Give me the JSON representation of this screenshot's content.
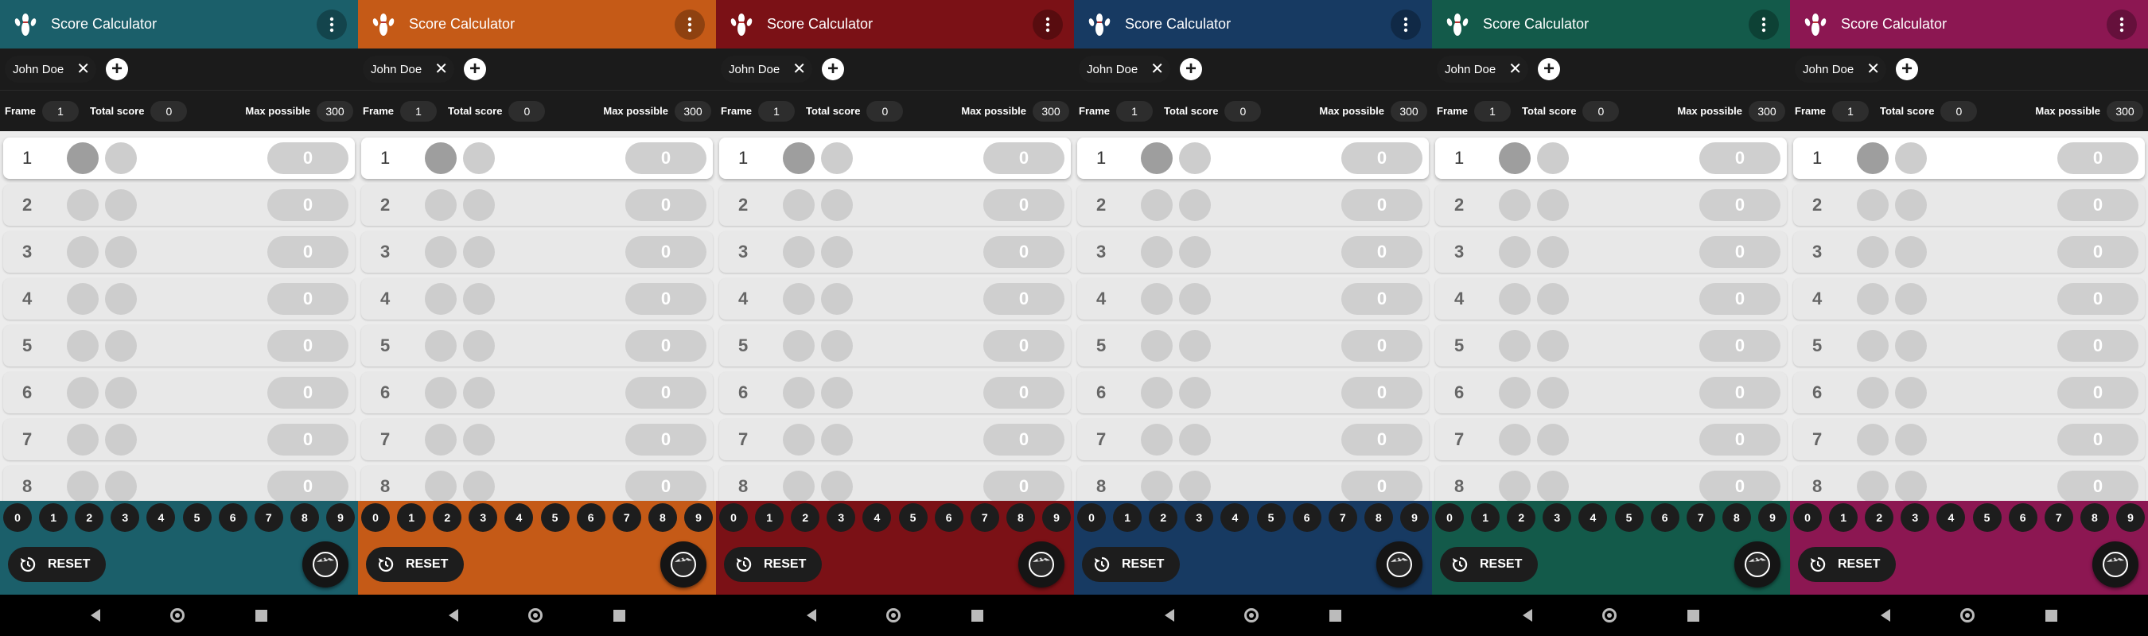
{
  "screens": [
    {
      "theme": {
        "appbar": "#1b5f6a",
        "chip": "#1e1e1e",
        "bottom": "#1b5f6a"
      },
      "app_title": "Score Calculator",
      "player_name": "John Doe",
      "stats": {
        "frame_label": "Frame",
        "frame_value": "1",
        "total_label": "Total score",
        "total_value": "0",
        "max_label": "Max possible",
        "max_value": "300"
      },
      "frames": [
        {
          "num": "1",
          "score": "0",
          "active": true
        },
        {
          "num": "2",
          "score": "0"
        },
        {
          "num": "3",
          "score": "0"
        },
        {
          "num": "4",
          "score": "0"
        },
        {
          "num": "5",
          "score": "0"
        },
        {
          "num": "6",
          "score": "0"
        },
        {
          "num": "7",
          "score": "0"
        },
        {
          "num": "8",
          "score": "0"
        }
      ],
      "pins": [
        "0",
        "1",
        "2",
        "3",
        "4",
        "5",
        "6",
        "7",
        "8",
        "9"
      ],
      "reset_label": "RESET"
    },
    {
      "theme": {
        "appbar": "#c55a17",
        "chip": "#1e1e1e",
        "bottom": "#c55a17"
      },
      "app_title": "Score Calculator",
      "player_name": "John Doe",
      "stats": {
        "frame_label": "Frame",
        "frame_value": "1",
        "total_label": "Total score",
        "total_value": "0",
        "max_label": "Max possible",
        "max_value": "300"
      },
      "frames": [
        {
          "num": "1",
          "score": "0",
          "active": true
        },
        {
          "num": "2",
          "score": "0"
        },
        {
          "num": "3",
          "score": "0"
        },
        {
          "num": "4",
          "score": "0"
        },
        {
          "num": "5",
          "score": "0"
        },
        {
          "num": "6",
          "score": "0"
        },
        {
          "num": "7",
          "score": "0"
        },
        {
          "num": "8",
          "score": "0"
        }
      ],
      "pins": [
        "0",
        "1",
        "2",
        "3",
        "4",
        "5",
        "6",
        "7",
        "8",
        "9"
      ],
      "reset_label": "RESET"
    },
    {
      "theme": {
        "appbar": "#7b1116",
        "chip": "#1e1e1e",
        "bottom": "#7b1116"
      },
      "app_title": "Score Calculator",
      "player_name": "John Doe",
      "stats": {
        "frame_label": "Frame",
        "frame_value": "1",
        "total_label": "Total score",
        "total_value": "0",
        "max_label": "Max possible",
        "max_value": "300"
      },
      "frames": [
        {
          "num": "1",
          "score": "0",
          "active": true
        },
        {
          "num": "2",
          "score": "0"
        },
        {
          "num": "3",
          "score": "0"
        },
        {
          "num": "4",
          "score": "0"
        },
        {
          "num": "5",
          "score": "0"
        },
        {
          "num": "6",
          "score": "0"
        },
        {
          "num": "7",
          "score": "0"
        },
        {
          "num": "8",
          "score": "0"
        }
      ],
      "pins": [
        "0",
        "1",
        "2",
        "3",
        "4",
        "5",
        "6",
        "7",
        "8",
        "9"
      ],
      "reset_label": "RESET"
    },
    {
      "theme": {
        "appbar": "#173a62",
        "chip": "#1e1e1e",
        "bottom": "#173a62"
      },
      "app_title": "Score Calculator",
      "player_name": "John Doe",
      "stats": {
        "frame_label": "Frame",
        "frame_value": "1",
        "total_label": "Total score",
        "total_value": "0",
        "max_label": "Max possible",
        "max_value": "300"
      },
      "frames": [
        {
          "num": "1",
          "score": "0",
          "active": true
        },
        {
          "num": "2",
          "score": "0"
        },
        {
          "num": "3",
          "score": "0"
        },
        {
          "num": "4",
          "score": "0"
        },
        {
          "num": "5",
          "score": "0"
        },
        {
          "num": "6",
          "score": "0"
        },
        {
          "num": "7",
          "score": "0"
        },
        {
          "num": "8",
          "score": "0"
        }
      ],
      "pins": [
        "0",
        "1",
        "2",
        "3",
        "4",
        "5",
        "6",
        "7",
        "8",
        "9"
      ],
      "reset_label": "RESET"
    },
    {
      "theme": {
        "appbar": "#135a4a",
        "chip": "#1e1e1e",
        "bottom": "#135a4a"
      },
      "app_title": "Score Calculator",
      "player_name": "John Doe",
      "stats": {
        "frame_label": "Frame",
        "frame_value": "1",
        "total_label": "Total score",
        "total_value": "0",
        "max_label": "Max possible",
        "max_value": "300"
      },
      "frames": [
        {
          "num": "1",
          "score": "0",
          "active": true
        },
        {
          "num": "2",
          "score": "0"
        },
        {
          "num": "3",
          "score": "0"
        },
        {
          "num": "4",
          "score": "0"
        },
        {
          "num": "5",
          "score": "0"
        },
        {
          "num": "6",
          "score": "0"
        },
        {
          "num": "7",
          "score": "0"
        },
        {
          "num": "8",
          "score": "0"
        }
      ],
      "pins": [
        "0",
        "1",
        "2",
        "3",
        "4",
        "5",
        "6",
        "7",
        "8",
        "9"
      ],
      "reset_label": "RESET"
    },
    {
      "theme": {
        "appbar": "#8c1752",
        "chip": "#1e1e1e",
        "bottom": "#8c1752"
      },
      "app_title": "Score Calculator",
      "player_name": "John Doe",
      "stats": {
        "frame_label": "Frame",
        "frame_value": "1",
        "total_label": "Total score",
        "total_value": "0",
        "max_label": "Max possible",
        "max_value": "300"
      },
      "frames": [
        {
          "num": "1",
          "score": "0",
          "active": true
        },
        {
          "num": "2",
          "score": "0"
        },
        {
          "num": "3",
          "score": "0"
        },
        {
          "num": "4",
          "score": "0"
        },
        {
          "num": "5",
          "score": "0"
        },
        {
          "num": "6",
          "score": "0"
        },
        {
          "num": "7",
          "score": "0"
        },
        {
          "num": "8",
          "score": "0"
        }
      ],
      "pins": [
        "0",
        "1",
        "2",
        "3",
        "4",
        "5",
        "6",
        "7",
        "8",
        "9"
      ],
      "reset_label": "RESET"
    }
  ]
}
